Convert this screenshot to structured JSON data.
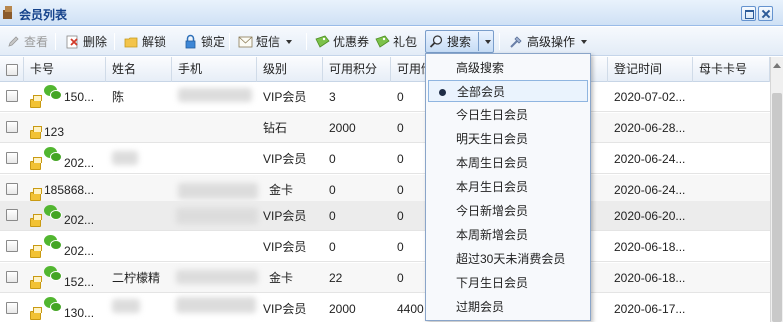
{
  "window": {
    "title": "会员列表"
  },
  "toolbar": {
    "view_label": "查看",
    "delete_label": "删除",
    "unlock_label": "解锁",
    "lock_label": "锁定",
    "sms_label": "短信",
    "coupon_label": "优惠券",
    "gift_label": "礼包",
    "search_label": "搜索",
    "advanced_ops_label": "高级操作"
  },
  "grid": {
    "columns": [
      "卡号",
      "姓名",
      "手机",
      "级别",
      "可用积分",
      "可用储",
      "",
      "登记时间",
      "母卡卡号"
    ],
    "rows": [
      {
        "card": "150...",
        "wechat": true,
        "name": "陈",
        "level": "VIP会员",
        "points": "3",
        "balance": "0",
        "date": "2020-07-02..."
      },
      {
        "card": "123",
        "wechat": false,
        "name": "",
        "level": "钻石",
        "points": "2000",
        "balance": "0",
        "date": "2020-06-28..."
      },
      {
        "card": "202...",
        "wechat": true,
        "name": "",
        "level": "VIP会员",
        "points": "0",
        "balance": "0",
        "date": "2020-06-24..."
      },
      {
        "card": "185868...",
        "wechat": false,
        "name": "",
        "level": "金卡",
        "points": "0",
        "balance": "0",
        "date": "2020-06-24..."
      },
      {
        "card": "202...",
        "wechat": true,
        "name": "",
        "level": "VIP会员",
        "points": "0",
        "balance": "0",
        "date": "2020-06-20..."
      },
      {
        "card": "202...",
        "wechat": true,
        "name": "",
        "level": "VIP会员",
        "points": "0",
        "balance": "0",
        "date": "2020-06-18..."
      },
      {
        "card": "152...",
        "wechat": true,
        "name": "二柠檬精",
        "level": "金卡",
        "points": "22",
        "balance": "0",
        "date": "2020-06-18..."
      },
      {
        "card": "130...",
        "wechat": true,
        "name": "",
        "level": "VIP会员",
        "points": "2000",
        "balance": "4400",
        "date": "2020-06-17..."
      }
    ]
  },
  "search_menu": {
    "items": [
      "高级搜索",
      "全部会员",
      "今日生日会员",
      "明天生日会员",
      "本周生日会员",
      "本月生日会员",
      "今日新增会员",
      "本周新增会员",
      "超过30天未消费会员",
      "下月生日会员",
      "过期会员"
    ],
    "selected": "全部会员"
  },
  "colors": {
    "title_text": "#15428b",
    "header_bg": "#dfe8f6",
    "wechat_green": "#52b630",
    "menu_active_border": "#8fb5e0"
  }
}
